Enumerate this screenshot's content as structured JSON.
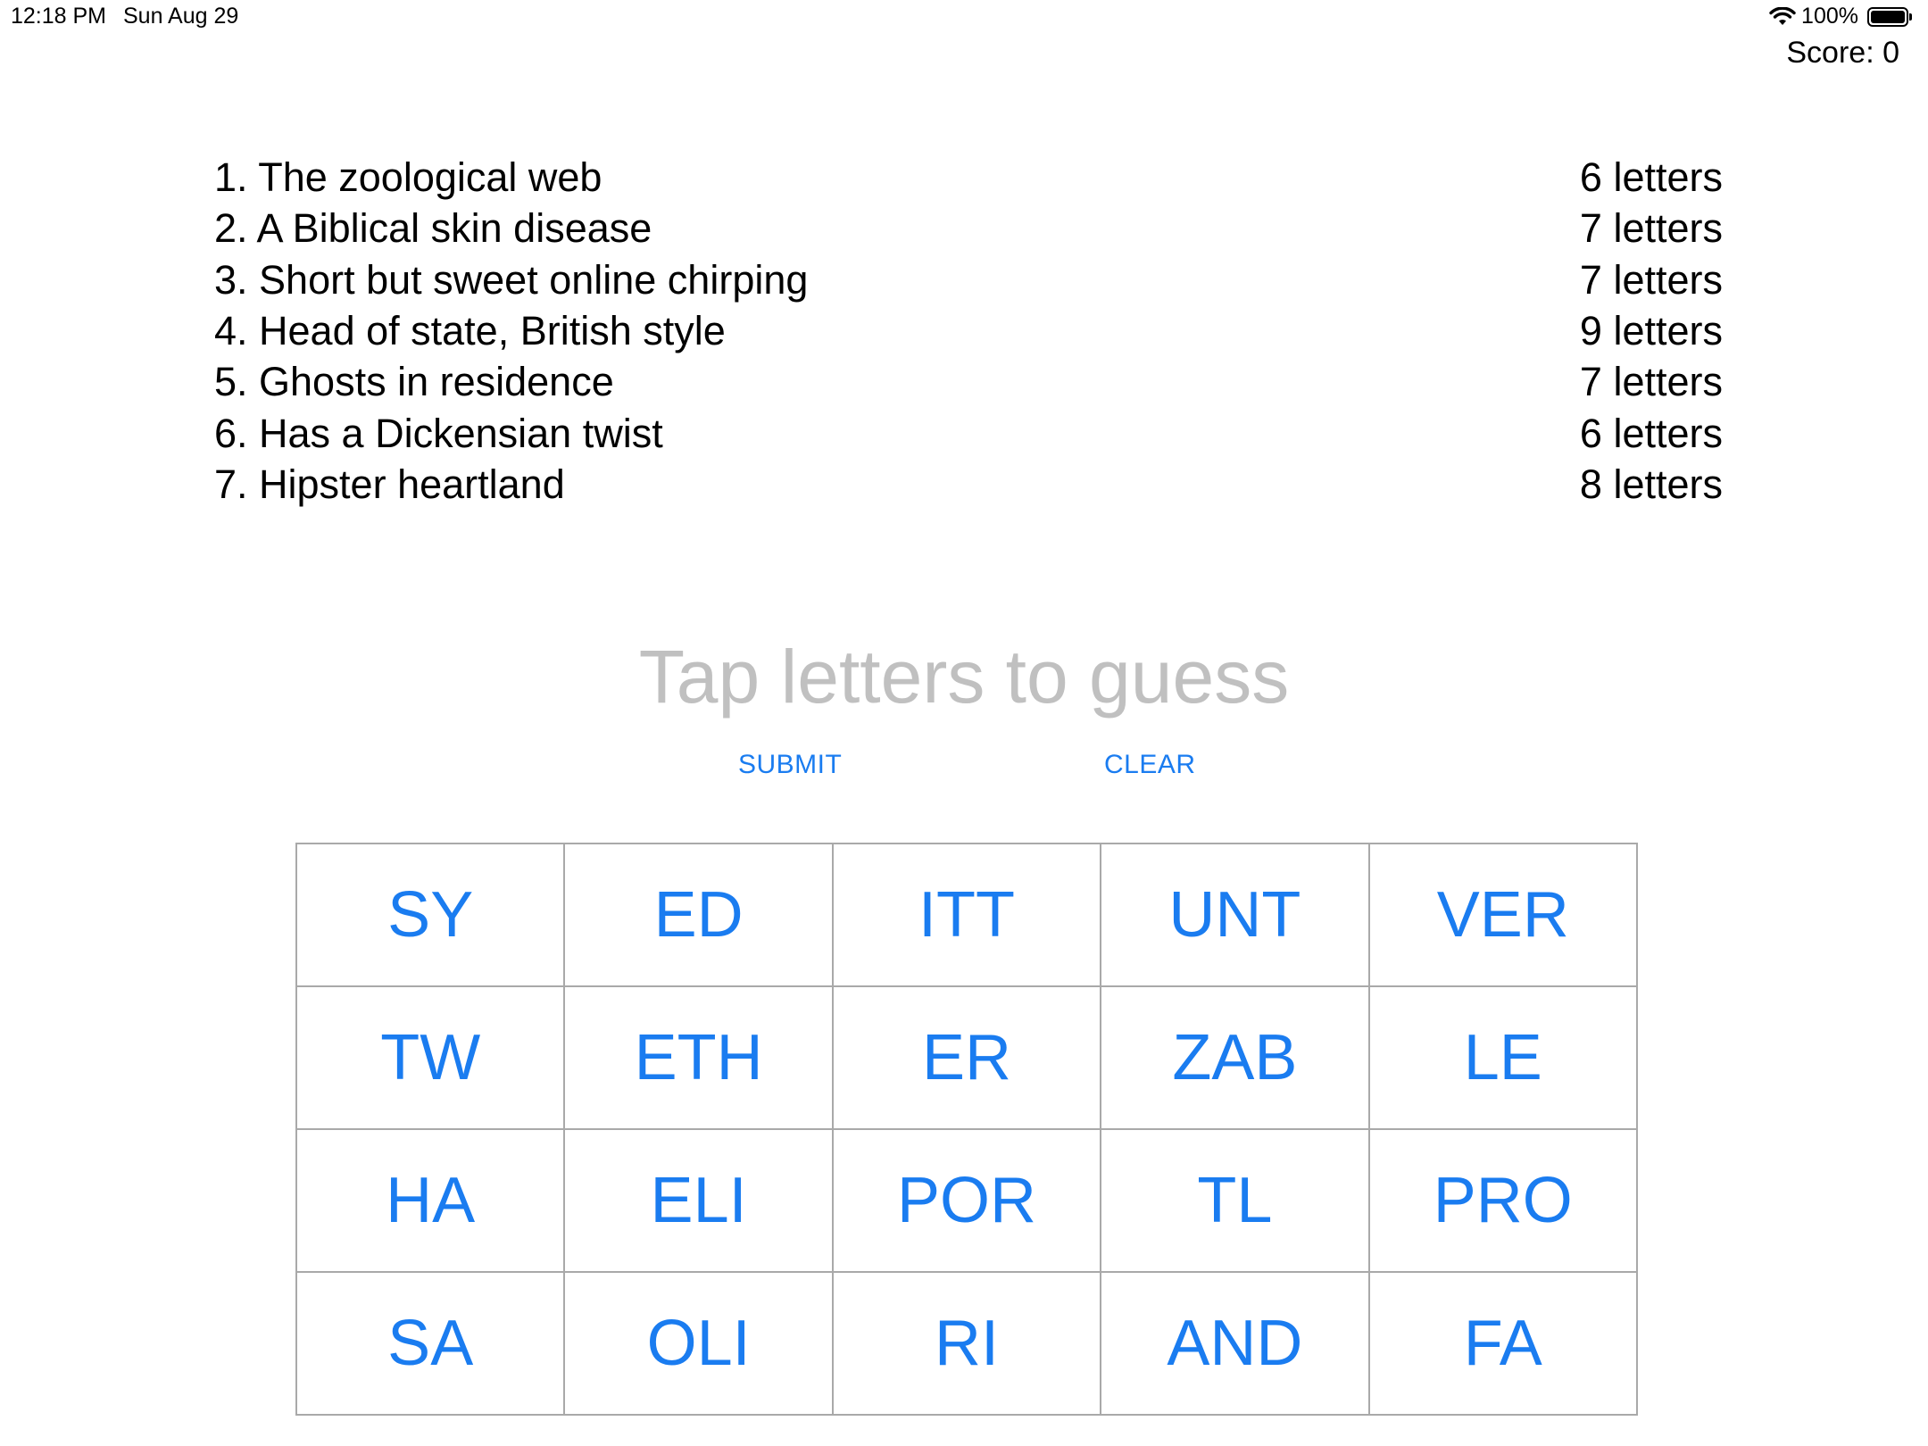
{
  "status_bar": {
    "time": "12:18 PM",
    "date": "Sun Aug 29",
    "battery_label": "100%",
    "battery_level": 1.0,
    "icons": [
      "wifi-icon",
      "battery-icon"
    ]
  },
  "score_label": "Score: 0",
  "clues": [
    {
      "text": "1. The zoological web",
      "length": "6 letters"
    },
    {
      "text": "2. A Biblical skin disease",
      "length": "7 letters"
    },
    {
      "text": "3. Short but sweet online chirping",
      "length": "7 letters"
    },
    {
      "text": "4. Head of state, British style",
      "length": "9 letters"
    },
    {
      "text": "5. Ghosts in residence",
      "length": "7 letters"
    },
    {
      "text": "6. Has a Dickensian twist",
      "length": "6 letters"
    },
    {
      "text": "7. Hipster heartland",
      "length": "8 letters"
    }
  ],
  "guess_prompt": "Tap letters to guess",
  "actions": {
    "submit_label": "SUBMIT",
    "clear_label": "CLEAR"
  },
  "tiles": [
    "SY",
    "ED",
    "ITT",
    "UNT",
    "VER",
    "TW",
    "ETH",
    "ER",
    "ZAB",
    "LE",
    "HA",
    "ELI",
    "POR",
    "TL",
    "PRO",
    "SA",
    "OLI",
    "RI",
    "AND",
    "FA"
  ],
  "colors": {
    "accent": "#1a7cf0",
    "prompt": "#c0c0c0",
    "grid_border": "#a9a9a9"
  }
}
